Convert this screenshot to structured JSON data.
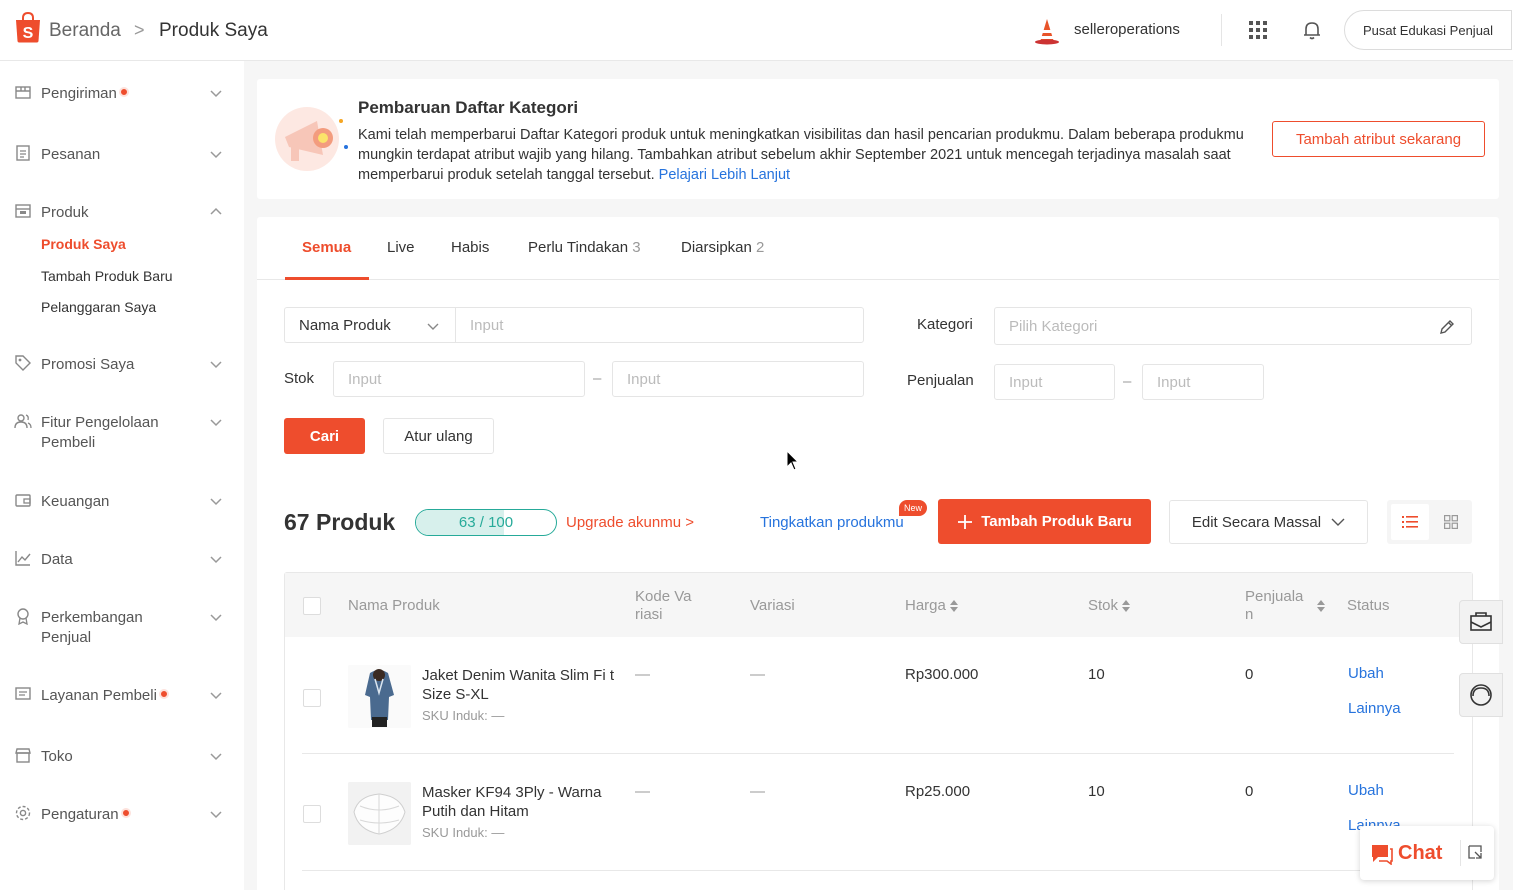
{
  "header": {
    "breadcrumb_home": "Beranda",
    "breadcrumb_sep": ">",
    "breadcrumb_current": "Produk Saya",
    "username": "selleroperations",
    "edu_button": "Pusat Edukasi Penjual"
  },
  "sidebar": {
    "items": [
      {
        "label": "Pengiriman",
        "dot": true
      },
      {
        "label": "Pesanan"
      },
      {
        "label": "Produk"
      },
      {
        "label": "Promosi Saya"
      },
      {
        "label": "Fitur Pengelolaan Pembeli"
      },
      {
        "label": "Keuangan"
      },
      {
        "label": "Data"
      },
      {
        "label": "Perkembangan Penjual"
      },
      {
        "label": "Layanan Pembeli",
        "dot": true
      },
      {
        "label": "Toko"
      },
      {
        "label": "Pengaturan",
        "dot": true
      }
    ],
    "produk_sub": [
      "Produk Saya",
      "Tambah Produk Baru",
      "Pelanggaran Saya"
    ]
  },
  "banner": {
    "title": "Pembaruan Daftar Kategori",
    "description": "Kami telah memperbarui Daftar Kategori produk untuk meningkatkan visibilitas dan hasil pencarian produkmu. Dalam beberapa produkmu mungkin terdapat atribut wajib yang hilang. Tambahkan atribut sebelum akhir September 2021 untuk mencegah terjadinya masalah saat memperbarui produk setelah tanggal tersebut.",
    "link": "Pelajari Lebih Lanjut",
    "button": "Tambah atribut sekarang"
  },
  "tabs": [
    {
      "label": "Semua",
      "count": ""
    },
    {
      "label": "Live",
      "count": ""
    },
    {
      "label": "Habis",
      "count": ""
    },
    {
      "label": "Perlu Tindakan",
      "count": "3"
    },
    {
      "label": "Diarsipkan",
      "count": "2"
    }
  ],
  "filters": {
    "name_select": "Nama Produk",
    "name_placeholder": "Input",
    "kategori_label": "Kategori",
    "kategori_placeholder": "Pilih Kategori",
    "stok_label": "Stok",
    "stok_min_placeholder": "Input",
    "stok_max_placeholder": "Input",
    "penjualan_label": "Penjualan",
    "penjualan_min_placeholder": "Input",
    "penjualan_max_placeholder": "Input",
    "range_sep": "–",
    "search_button": "Cari",
    "reset_button": "Atur ulang"
  },
  "toolbar": {
    "count_label": "67 Produk",
    "quota_text": "63 / 100",
    "quota_fraction": 0.63,
    "upgrade_link": "Upgrade akunmu >",
    "improve_link": "Tingkatkan produkmu",
    "new_badge": "New",
    "add_button": "Tambah Produk Baru",
    "mass_edit_button": "Edit Secara Massal"
  },
  "table": {
    "columns": [
      "Nama Produk",
      "Kode Va riasi",
      "Variasi",
      "Harga",
      "Stok",
      "Penjuala n",
      "Status"
    ],
    "rows": [
      {
        "name": "Jaket Denim Wanita Slim Fi t Size S-XL",
        "sku": "SKU Induk: —",
        "kode_variasi": "—",
        "variasi": "—",
        "harga": "Rp300.000",
        "stok": "10",
        "penjualan": "0",
        "actions": [
          "Ubah",
          "Lainnya"
        ]
      },
      {
        "name": "Masker KF94 3Ply - Warna Putih dan Hitam",
        "sku": "SKU Induk: —",
        "kode_variasi": "—",
        "variasi": "—",
        "harga": "Rp25.000",
        "stok": "10",
        "penjualan": "0",
        "actions": [
          "Ubah",
          "Lainnya"
        ]
      }
    ]
  },
  "chat": {
    "label": "Chat"
  },
  "colors": {
    "brand": "#ee4d2d",
    "link": "#2673dd",
    "quota": "#26aa99"
  }
}
